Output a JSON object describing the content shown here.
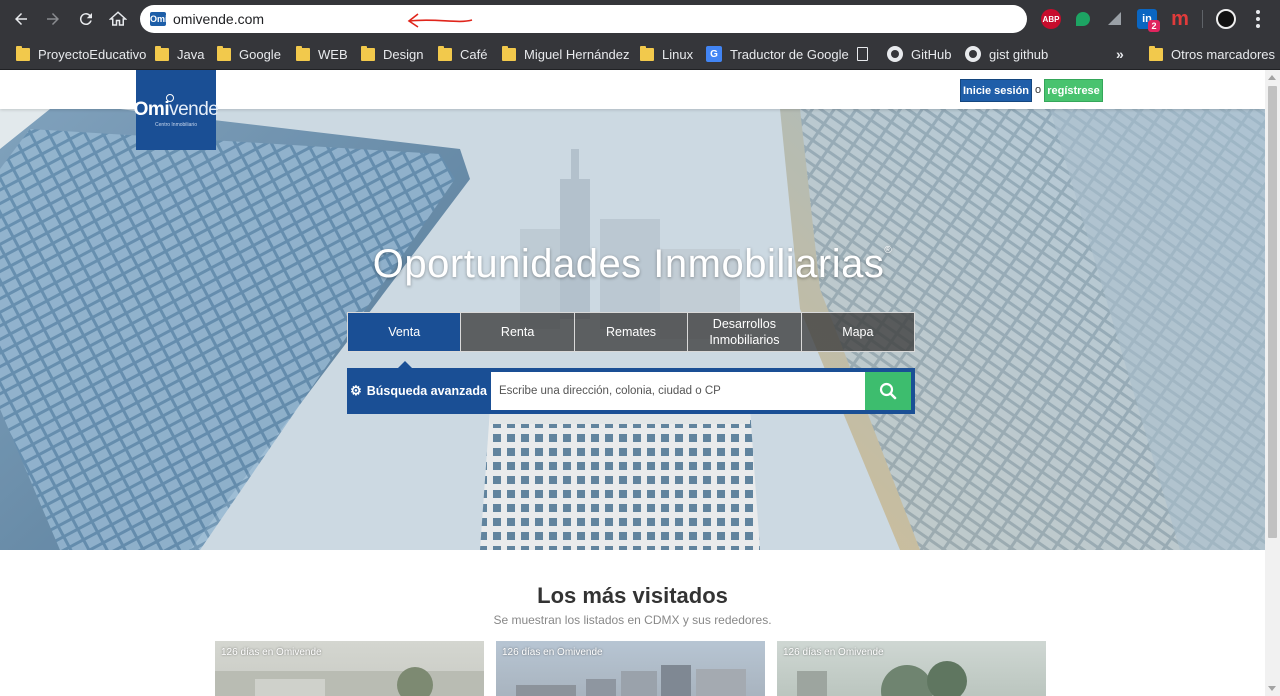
{
  "browser": {
    "url": "omivende.com",
    "site_badge": "Omi",
    "extensions": {
      "abp": "ABP",
      "linkedin": "in",
      "linkedin_badge": "2",
      "m": "m"
    },
    "bookmarks": [
      {
        "label": "ProyectoEducativo",
        "icon": "folder-icon"
      },
      {
        "label": "Java",
        "icon": "folder-icon"
      },
      {
        "label": "Google",
        "icon": "folder-icon"
      },
      {
        "label": "WEB",
        "icon": "folder-icon"
      },
      {
        "label": "Design",
        "icon": "folder-icon"
      },
      {
        "label": "Café",
        "icon": "folder-icon"
      },
      {
        "label": "Miguel Hernández",
        "icon": "folder-icon"
      },
      {
        "label": "Linux",
        "icon": "folder-icon"
      },
      {
        "label": "Traductor de Google",
        "icon": "google-translate-icon"
      },
      {
        "label": "",
        "icon": "page-icon"
      },
      {
        "label": "GitHub",
        "icon": "github-icon"
      },
      {
        "label": "gist github",
        "icon": "github-icon"
      }
    ],
    "more_bookmarks": "»",
    "other_bookmarks": "Otros marcadores"
  },
  "header": {
    "logo_main": "Omi",
    "logo_rest": "vende",
    "logo_sub": "Centro Inmobiliario",
    "login_label": "Inicie sesión",
    "or_label": "o",
    "register_label": "regístrese"
  },
  "hero": {
    "title": "Oportunidades Inmobiliarias",
    "title_mark": "®",
    "tabs": [
      "Venta",
      "Renta",
      "Remates",
      "Desarrollos\nInmobiliarios",
      "Mapa"
    ],
    "active_tab": "Venta",
    "advanced_search_label": "Búsqueda avanzada",
    "search_placeholder": "Escribe una dirección, colonia, ciudad o CP"
  },
  "most_visited": {
    "title": "Los más visitados",
    "subtitle": "Se muestran los listados en CDMX y sus rededores.",
    "cards": [
      {
        "label": "126 días en Omivende"
      },
      {
        "label": "126 días en Omivende"
      },
      {
        "label": "126 días en Omivende"
      }
    ]
  },
  "colors": {
    "brand_blue": "#1a4f95",
    "brand_green": "#3dbd6e",
    "register_green": "#49c36f",
    "annotation_red": "#e0251b"
  }
}
